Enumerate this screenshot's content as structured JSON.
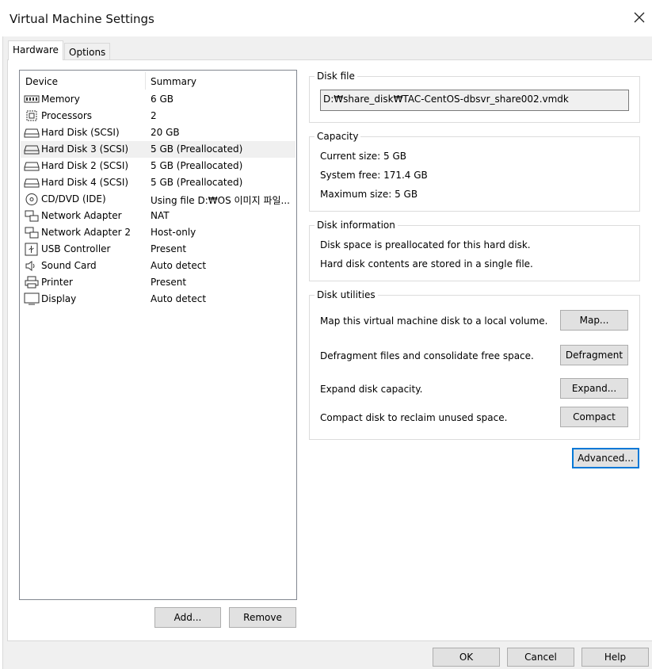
{
  "window": {
    "title": "Virtual Machine Settings",
    "close_icon": "close-icon"
  },
  "tabs": [
    {
      "label": "Hardware",
      "active": true
    },
    {
      "label": "Options",
      "active": false
    }
  ],
  "device_list": {
    "columns": [
      "Device",
      "Summary"
    ],
    "rows": [
      {
        "icon": "memory-icon",
        "device": "Memory",
        "summary": "6 GB",
        "selected": false
      },
      {
        "icon": "processor-icon",
        "device": "Processors",
        "summary": "2",
        "selected": false
      },
      {
        "icon": "hard-disk-icon",
        "device": "Hard Disk (SCSI)",
        "summary": "20 GB",
        "selected": false
      },
      {
        "icon": "hard-disk-icon",
        "device": "Hard Disk 3 (SCSI)",
        "summary": "5 GB (Preallocated)",
        "selected": true
      },
      {
        "icon": "hard-disk-icon",
        "device": "Hard Disk 2 (SCSI)",
        "summary": "5 GB (Preallocated)",
        "selected": false
      },
      {
        "icon": "hard-disk-icon",
        "device": "Hard Disk 4 (SCSI)",
        "summary": "5 GB (Preallocated)",
        "selected": false
      },
      {
        "icon": "cd-dvd-icon",
        "device": "CD/DVD (IDE)",
        "summary": "Using file D:₩OS 이미지 파일...",
        "selected": false
      },
      {
        "icon": "network-adapter-icon",
        "device": "Network Adapter",
        "summary": "NAT",
        "selected": false
      },
      {
        "icon": "network-adapter-icon",
        "device": "Network Adapter 2",
        "summary": "Host-only",
        "selected": false
      },
      {
        "icon": "usb-icon",
        "device": "USB Controller",
        "summary": "Present",
        "selected": false
      },
      {
        "icon": "speaker-icon",
        "device": "Sound Card",
        "summary": "Auto detect",
        "selected": false
      },
      {
        "icon": "printer-icon",
        "device": "Printer",
        "summary": "Present",
        "selected": false
      },
      {
        "icon": "display-icon",
        "device": "Display",
        "summary": "Auto detect",
        "selected": false
      }
    ],
    "add_label": "Add...",
    "remove_label": "Remove"
  },
  "disk_file": {
    "label": "Disk file",
    "path": "D:₩share_disk₩TAC-CentOS-dbsvr_share002.vmdk"
  },
  "capacity": {
    "label": "Capacity",
    "current": "Current size: 5 GB",
    "free": "System free: 171.4 GB",
    "maximum": "Maximum size: 5 GB"
  },
  "disk_info": {
    "label": "Disk information",
    "line1": "Disk space is preallocated for this hard disk.",
    "line2": "Hard disk contents are stored in a single file."
  },
  "disk_utilities": {
    "label": "Disk utilities",
    "map_text": "Map this virtual machine disk to a local volume.",
    "map_button": "Map...",
    "defrag_text": "Defragment files and consolidate free space.",
    "defrag_button": "Defragment",
    "expand_text": "Expand disk capacity.",
    "expand_button": "Expand...",
    "compact_text": "Compact disk to reclaim unused space.",
    "compact_button": "Compact"
  },
  "advanced_button": "Advanced...",
  "footer": {
    "ok": "OK",
    "cancel": "Cancel",
    "help": "Help"
  }
}
